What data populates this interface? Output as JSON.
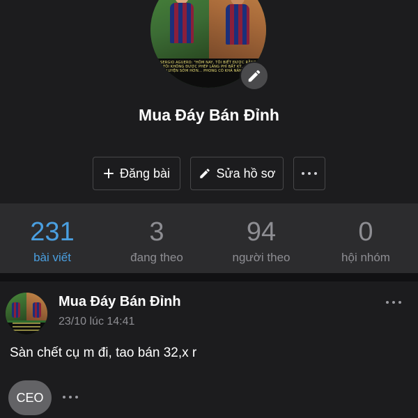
{
  "profile": {
    "name": "Mua Đáy Bán Đỉnh",
    "avatar_caption": "SERGIO AGUERO: \"HÔM NAY, TÔI BIẾT ĐƯỢC RẰNG TÔI KHÔNG ĐƯỢC PHÉP LÃNG PHÍ BẤT KỲ... TẬP LUYỆN SỚM HƠN... PHONG CÓ KHẢ NĂNG...\""
  },
  "actions": {
    "post_label": "Đăng bài",
    "edit_profile_label": "Sửa hồ sơ"
  },
  "stats": [
    {
      "value": "231",
      "label": "bài viết",
      "active": true
    },
    {
      "value": "3",
      "label": "đang theo",
      "active": false
    },
    {
      "value": "94",
      "label": "người theo",
      "active": false
    },
    {
      "value": "0",
      "label": "hội nhóm",
      "active": false
    }
  ],
  "post": {
    "author": "Mua Đáy Bán Đỉnh",
    "time": "23/10 lúc 14:41",
    "content": "Sàn chết cụ m đi, tao bán 32,x r",
    "badge": "CEO"
  },
  "colors": {
    "background": "#1c1c1e",
    "stats_bar": "#2c2c2e",
    "accent": "#4a9fe0",
    "muted_text": "#8e8e93"
  }
}
